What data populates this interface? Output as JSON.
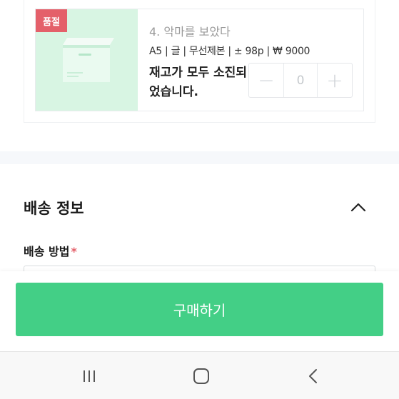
{
  "order_item": {
    "badge": "품절",
    "title": "4. 악마를 보았다",
    "meta": "A5 | 글 | 무선제본 | ± 98p | ₩ 9000",
    "stock_message": "재고가 모두 소진되었습니다.",
    "quantity": "0",
    "decrement_symbol": "−",
    "increment_symbol": "+"
  },
  "shipping": {
    "title": "배송 정보",
    "method_label": "배송 방법",
    "required_marker": "*",
    "collapse_icon": "chevron-up-icon"
  },
  "footer": {
    "buy_label": "구매하기"
  },
  "navbar": {
    "recent_icon": "recent-apps-icon",
    "home_icon": "home-icon",
    "back_icon": "back-icon"
  },
  "colors": {
    "accent_green": "#43cf86",
    "soldout_red": "#e4606a",
    "thumb_bg": "#d8f5e3"
  }
}
